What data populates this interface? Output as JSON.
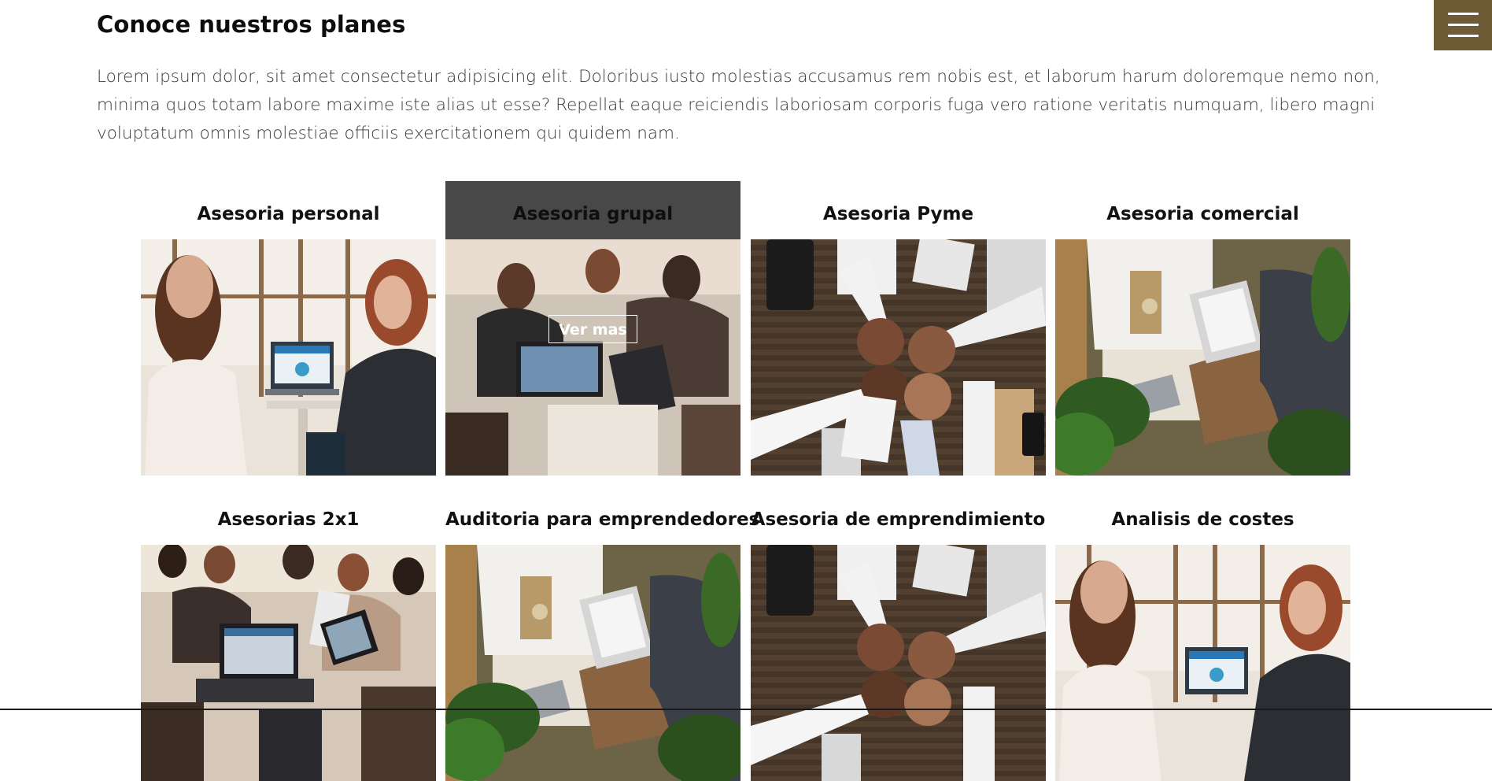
{
  "section": {
    "title": "Conoce nuestros planes",
    "intro": "Lorem ipsum dolor, sit amet consectetur adipisicing elit. Doloribus iusto molestias accusamus rem nobis est, et laborum harum doloremque nemo non, minima quos totam labore maxime iste alias ut esse? Repellat eaque reiciendis laboriosam corporis fuga vero ratione veritatis numquam, libero magni voluptatum omnis molestiae officiis exercitationem qui quidem nam."
  },
  "menu": {
    "icon": "hamburger-menu-icon",
    "background_color": "#6f5b36"
  },
  "plans": [
    {
      "title": "Asesoria personal",
      "photo": "two-women-laptop-photo"
    },
    {
      "title": "Asesoria grupal",
      "photo": "group-laptops-photo",
      "hovered": true,
      "button_label": "Ver mas"
    },
    {
      "title": "Asesoria Pyme",
      "photo": "fist-bump-desk-photo"
    },
    {
      "title": "Asesoria comercial",
      "photo": "meeting-laptop-plants-photo"
    },
    {
      "title": "Asesorias 2x1",
      "photo": "group-laptops-photo"
    },
    {
      "title": "Auditoria para emprendedores",
      "photo": "meeting-laptop-plants-photo"
    },
    {
      "title": "Asesoria de emprendimiento",
      "photo": "fist-bump-desk-photo"
    },
    {
      "title": "Analisis de costes",
      "photo": "two-women-laptop-photo"
    }
  ]
}
